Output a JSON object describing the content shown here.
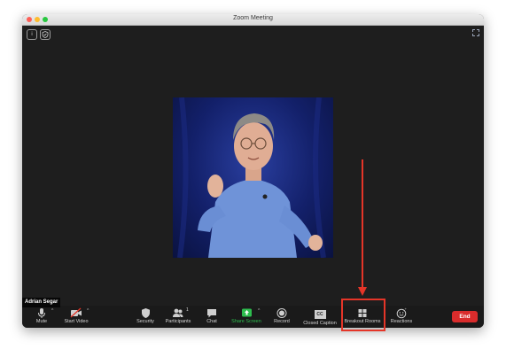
{
  "window": {
    "title": "Zoom Meeting"
  },
  "video": {
    "participant_name": "Adrian Segar"
  },
  "toolbar": {
    "mute_label": "Mute",
    "start_video_label": "Start Video",
    "security_label": "Security",
    "participants_label": "Participants",
    "participants_count": "1",
    "chat_label": "Chat",
    "share_screen_label": "Share Screen",
    "record_label": "Record",
    "closed_caption_label": "Closed Caption",
    "closed_caption_icon_text": "CC",
    "breakout_rooms_label": "Breakout Rooms",
    "reactions_label": "Reactions",
    "end_label": "End"
  },
  "colors": {
    "end_button": "#d92c2c",
    "share_screen": "#2dbd4e",
    "annotation": "#e53528"
  }
}
